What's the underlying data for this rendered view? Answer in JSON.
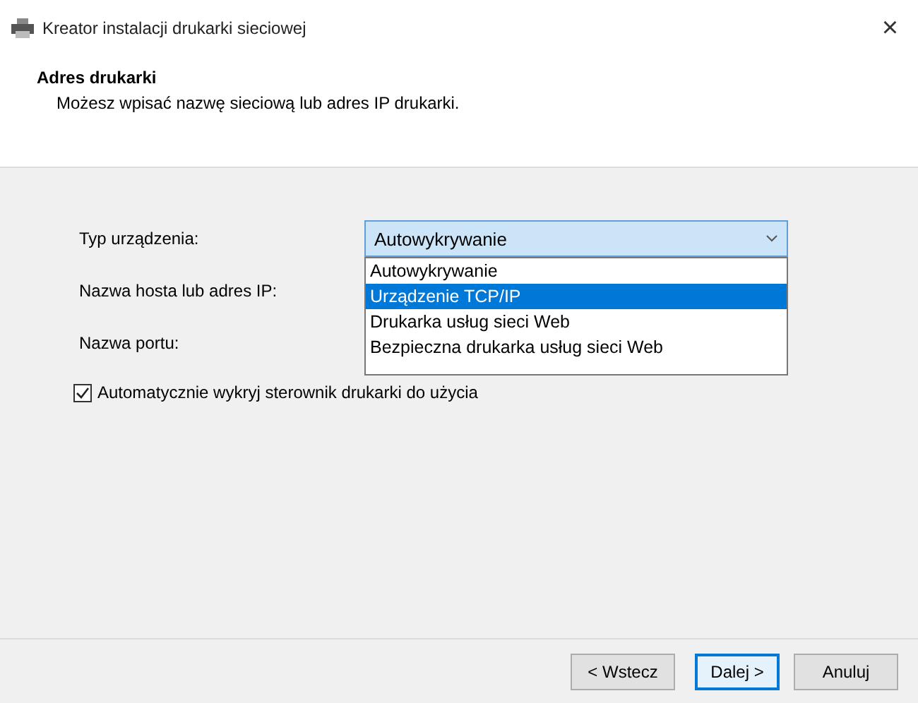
{
  "window": {
    "title": "Kreator instalacji drukarki sieciowej",
    "close": "×"
  },
  "header": {
    "title": "Adres drukarki",
    "subtitle": "Możesz wpisać nazwę sieciową lub adres IP drukarki."
  },
  "form": {
    "labels": [
      "Typ urządzenia:",
      "Nazwa hosta lub adres IP:",
      "Nazwa portu:"
    ],
    "device_type": {
      "value": "Autowykrywanie",
      "expanded": true,
      "options": [
        {
          "label": "Autowykrywanie",
          "highlighted": false
        },
        {
          "label": "Urządzenie TCP/IP",
          "highlighted": true
        },
        {
          "label": "Drukarka usług sieci Web",
          "highlighted": false
        },
        {
          "label": "Bezpieczna drukarka usług sieci Web",
          "highlighted": false
        }
      ]
    },
    "auto_driver": {
      "label": "Automatycznie wykryj sterownik drukarki do użycia",
      "checked": true
    }
  },
  "buttons": [
    {
      "label": "< Wstecz",
      "default": false
    },
    {
      "label": "Dalej >",
      "default": true
    },
    {
      "label": "Anuluj",
      "default": false
    }
  ]
}
